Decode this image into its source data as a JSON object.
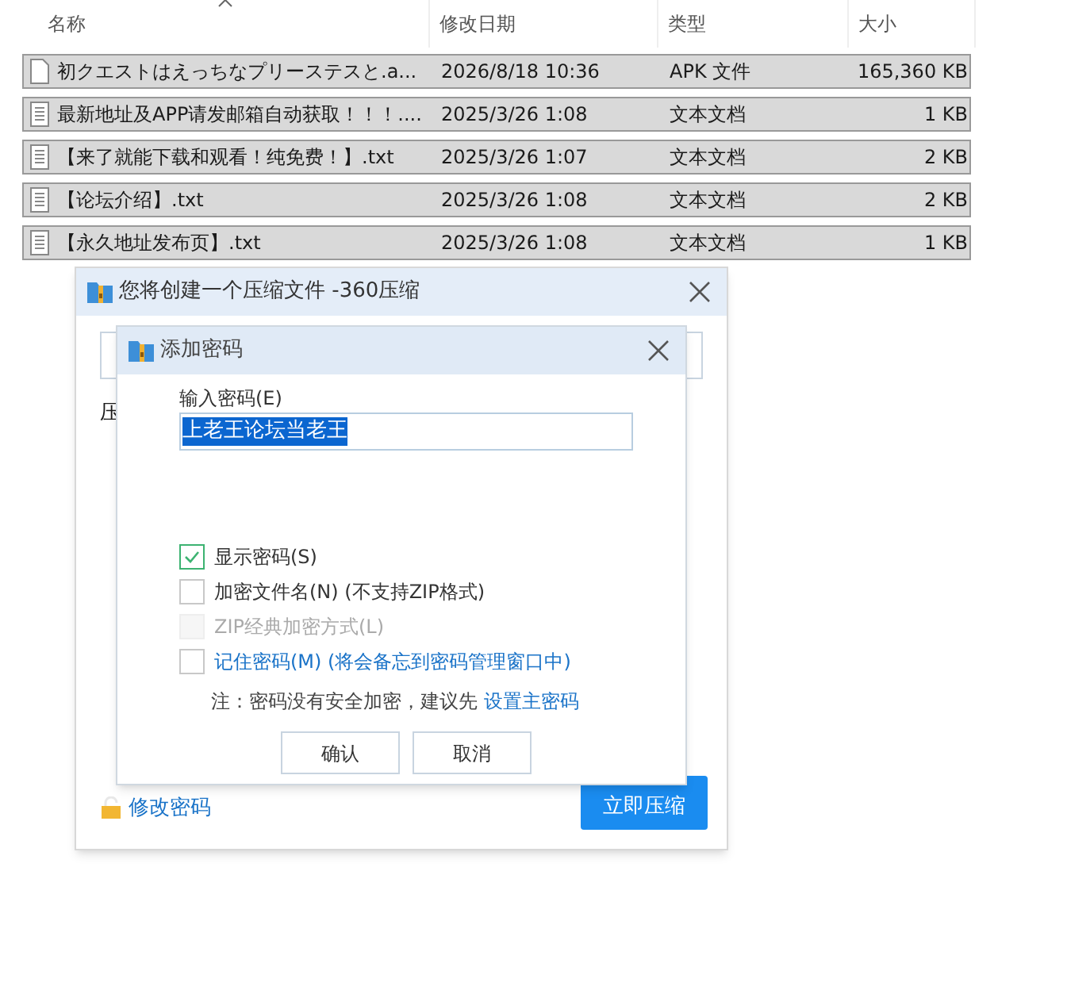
{
  "file_list": {
    "columns": [
      {
        "label": "名称",
        "sorted": true
      },
      {
        "label": "修改日期",
        "sorted": false
      },
      {
        "label": "类型",
        "sorted": false
      },
      {
        "label": "大小",
        "sorted": false
      }
    ],
    "rows": [
      {
        "name": "初クエストはえっちなプリーステスと.a...",
        "date": "2026/8/18 10:36",
        "type": "APK 文件",
        "size": "165,360 KB",
        "kind": "blank",
        "selected": true
      },
      {
        "name": "最新地址及APP请发邮箱自动获取！！！....",
        "date": "2025/3/26 1:08",
        "type": "文本文档",
        "size": "1 KB",
        "kind": "text",
        "selected": true
      },
      {
        "name": "【来了就能下载和观看！纯免费！】.txt",
        "date": "2025/3/26 1:07",
        "type": "文本文档",
        "size": "2 KB",
        "kind": "text",
        "selected": true
      },
      {
        "name": "【论坛介绍】.txt",
        "date": "2025/3/26 1:08",
        "type": "文本文档",
        "size": "2 KB",
        "kind": "text",
        "selected": true
      },
      {
        "name": "【永久地址发布页】.txt",
        "date": "2025/3/26 1:08",
        "type": "文本文档",
        "size": "1 KB",
        "kind": "text",
        "selected": true
      }
    ]
  },
  "compress_dialog": {
    "title": "您将创建一个压缩文件 -360压缩",
    "field_label": "压",
    "change_password_link": "修改密码",
    "compress_button": "立即压缩"
  },
  "password_dialog": {
    "title": "添加密码",
    "password_label": "输入密码(E)",
    "password_value": "上老王论坛当老王",
    "options": [
      {
        "label": "显示密码(S)",
        "checked": true,
        "disabled": false,
        "link": false
      },
      {
        "label": "加密文件名(N) (不支持ZIP格式)",
        "checked": false,
        "disabled": false,
        "link": false
      },
      {
        "label": "ZIP经典加密方式(L)",
        "checked": false,
        "disabled": true,
        "link": false
      },
      {
        "label": "记住密码(M) (将会备忘到密码管理窗口中)",
        "checked": false,
        "disabled": false,
        "link": true
      }
    ],
    "note": "注：密码没有安全加密，建议先",
    "note_link": "设置主密码",
    "buttons": [
      "确认",
      "取消"
    ]
  }
}
